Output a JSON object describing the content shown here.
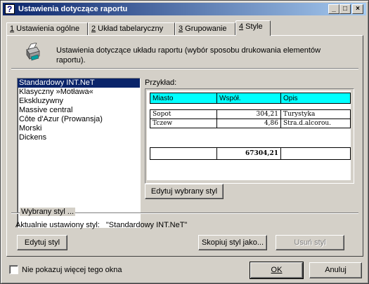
{
  "window": {
    "title": "Ustawienia dotyczące raportu"
  },
  "titlebar_buttons": {
    "minimize": "_",
    "maximize": "□",
    "close": "×"
  },
  "tabs": [
    {
      "key": "1",
      "label": " Ustawienia ogólne"
    },
    {
      "key": "2",
      "label": " Układ tabelaryczny"
    },
    {
      "key": "3",
      "label": " Grupowanie"
    },
    {
      "key": "4",
      "label": " Style",
      "active": true
    }
  ],
  "header": {
    "text": "Ustawienia dotyczące układu raportu (wybór sposobu drukowania elementów raportu).",
    "icon": "printer-icon"
  },
  "styles_list": [
    "Standardowy INT.NeT",
    "Klasyczny »Motława«",
    "Ekskluzywny",
    "Massive central",
    "Côte d'Azur (Prowansja)",
    "Morski",
    "Dickens"
  ],
  "selected_index": 0,
  "preview": {
    "label": "Przykład:",
    "headers": [
      "Miasto",
      "Współ.",
      "Opis"
    ],
    "rows": [
      [
        "Sopot",
        "304,21",
        "Turystyka"
      ],
      [
        "Tczew",
        "4,86",
        "Stra.d.alcorou."
      ]
    ],
    "total": "67304,21",
    "header_color": "#00ffff"
  },
  "buttons": {
    "edit_selected": "Edytuj wybrany styl",
    "edit_style": "Edytuj styl",
    "copy_style": "Skopiuj styl jako...",
    "delete_style": "Usuń styl",
    "ok": "OK",
    "cancel": "Anuluj"
  },
  "selected_group": {
    "label": "Wybrany styl ...",
    "current_prefix": "Aktualnie ustawiony styl:",
    "current_value": "\"Standardowy INT.NeT\""
  },
  "checkbox": {
    "label": "Nie pokazuj więcej tego okna",
    "checked": false
  },
  "colors": {
    "titlebar": "#0a246a",
    "selection": "#0a246a",
    "face": "#d4d0c8"
  }
}
